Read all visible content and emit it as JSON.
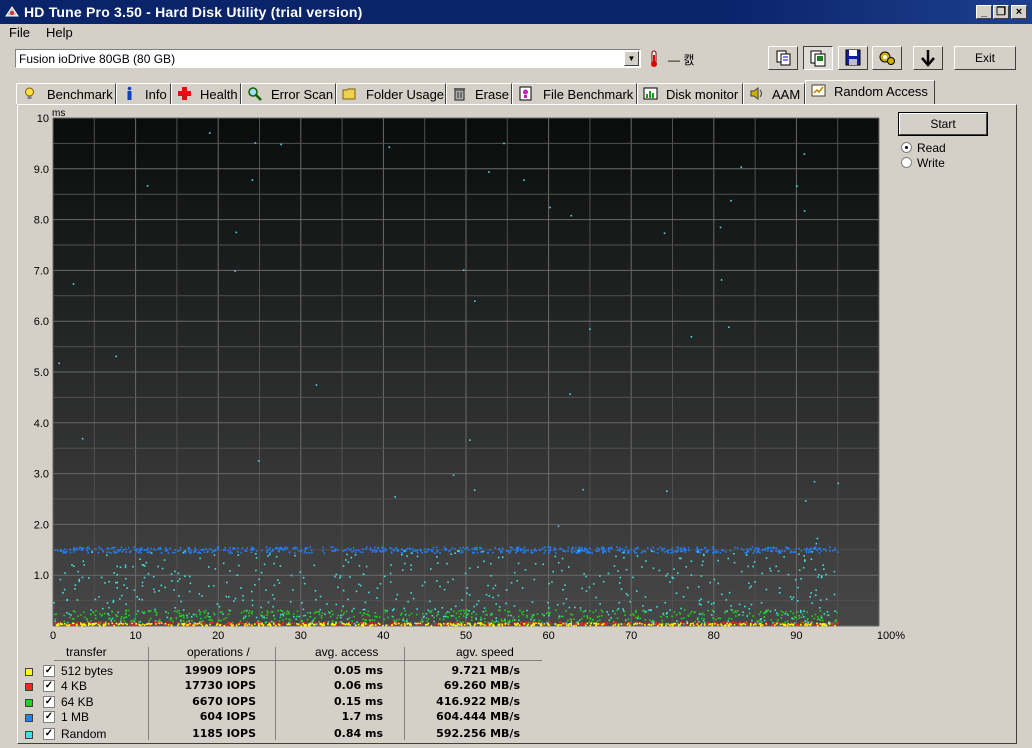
{
  "window": {
    "title": "HD Tune Pro 3.50 - Hard Disk Utility (trial version)"
  },
  "menu": [
    "File",
    "Help"
  ],
  "toolbar": {
    "drive": "Fusion ioDrive 80GB  (80 GB)",
    "temperature": "— 캜",
    "exit_label": "Exit"
  },
  "tabs": [
    {
      "label": "Benchmark",
      "icon": "bulb-icon"
    },
    {
      "label": "Info",
      "icon": "info-icon"
    },
    {
      "label": "Health",
      "icon": "health-cross-icon"
    },
    {
      "label": "Error Scan",
      "icon": "magnifier-icon"
    },
    {
      "label": "Folder Usage",
      "icon": "folder-icon"
    },
    {
      "label": "Erase",
      "icon": "trash-icon"
    },
    {
      "label": "File Benchmark",
      "icon": "file-benchmark-icon"
    },
    {
      "label": "Disk monitor",
      "icon": "monitor-chart-icon"
    },
    {
      "label": "AAM",
      "icon": "speaker-icon"
    },
    {
      "label": "Random Access",
      "icon": "random-access-icon"
    }
  ],
  "active_tab": "Random Access",
  "controls": {
    "start_label": "Start",
    "read_label": "Read",
    "write_label": "Write",
    "mode": "Read"
  },
  "colors": {
    "s512": "#ffff00",
    "s4k": "#ff2020",
    "s64k": "#20d020",
    "s1m": "#2080ff",
    "random": "#40e0e0"
  },
  "chart_data": {
    "type": "scatter",
    "ylabel": "ms",
    "ylim": [
      0,
      10
    ],
    "xlim": [
      0,
      100
    ],
    "y_ticks": [
      "1.0",
      "2.0",
      "3.0",
      "4.0",
      "5.0",
      "6.0",
      "7.0",
      "8.0",
      "9.0",
      "10"
    ],
    "x_ticks": [
      "0",
      "10",
      "20",
      "30",
      "40",
      "50",
      "60",
      "70",
      "80",
      "90",
      "100%"
    ],
    "grid": true,
    "series": [
      {
        "name": "512 bytes",
        "color": "#ffff00",
        "approx_access_ms": 0.05
      },
      {
        "name": "4 KB",
        "color": "#ff2020",
        "approx_access_ms": 0.06
      },
      {
        "name": "64 KB",
        "color": "#20d020",
        "approx_access_ms": 0.15
      },
      {
        "name": "1 MB",
        "color": "#2080ff",
        "approx_access_ms": 1.5
      },
      {
        "name": "Random",
        "color": "#40e0e0",
        "approx_access_ms": 0.84
      }
    ]
  },
  "results": {
    "headers": [
      "transfer",
      "operations /",
      "avg. access",
      "agv. speed"
    ],
    "rows": [
      {
        "name": "512 bytes",
        "ops": "19909 IOPS",
        "access": "0.05 ms",
        "speed": "9.721 MB/s"
      },
      {
        "name": "4 KB",
        "ops": "17730 IOPS",
        "access": "0.06 ms",
        "speed": "69.260 MB/s"
      },
      {
        "name": "64 KB",
        "ops": "6670 IOPS",
        "access": "0.15 ms",
        "speed": "416.922 MB/s"
      },
      {
        "name": "1 MB",
        "ops": "604 IOPS",
        "access": "1.7 ms",
        "speed": "604.444 MB/s"
      },
      {
        "name": "Random",
        "ops": "1185 IOPS",
        "access": "0.84 ms",
        "speed": "592.256 MB/s"
      }
    ]
  }
}
